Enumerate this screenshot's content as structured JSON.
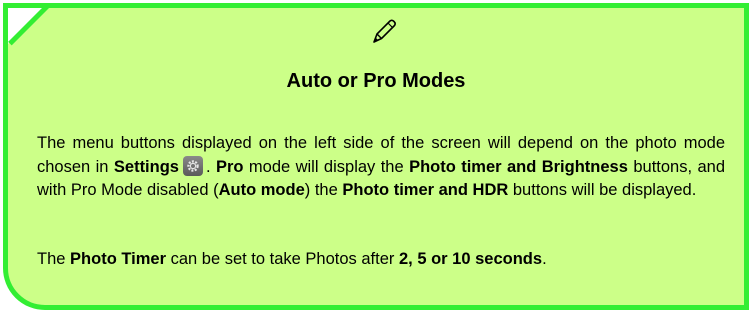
{
  "note": {
    "title": "Auto or Pro Modes",
    "para1": {
      "t1": "The menu buttons displayed on the left side of the screen will depend on the photo mode chosen in ",
      "settings": "Settings",
      "t2": ". ",
      "pro": "Pro",
      "t3": " mode will display the ",
      "photo_timer_brightness": "Photo timer and Brightness",
      "t4": " buttons, and with Pro Mode disabled (",
      "auto_mode": "Auto mode",
      "t5": ") the ",
      "photo_timer_hdr": "Photo timer and HDR",
      "t6": " buttons will be displayed."
    },
    "para2": {
      "t1": "The ",
      "photo_timer": "Photo Timer",
      "t2": " can be set to take Photos after ",
      "seconds": "2, 5 or 10 seconds",
      "t3": "."
    },
    "icons": {
      "header": "pencil-icon",
      "inline": "settings-gear-icon"
    },
    "colors": {
      "background": "#ccff88",
      "border": "#33ee33"
    }
  }
}
